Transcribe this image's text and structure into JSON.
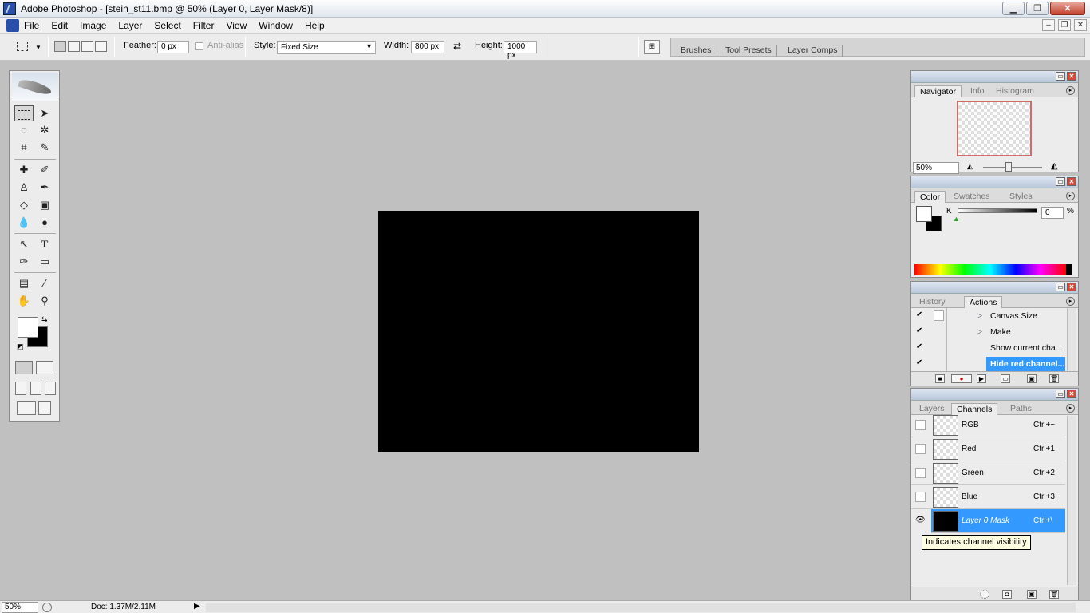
{
  "window": {
    "title": "Adobe Photoshop - [stein_st11.bmp @ 50% (Layer 0, Layer Mask/8)]",
    "min_glyph": "▁",
    "max_glyph": "❐",
    "close_glyph": "✕"
  },
  "menu": {
    "items": [
      "File",
      "Edit",
      "Image",
      "Layer",
      "Select",
      "Filter",
      "View",
      "Window",
      "Help"
    ],
    "doc_min": "–",
    "doc_restore": "❐",
    "doc_close": "✕"
  },
  "options": {
    "feather_label": "Feather:",
    "feather_value": "0 px",
    "antialias_label": "Anti-alias",
    "style_label": "Style:",
    "style_value": "Fixed Size",
    "width_label": "Width:",
    "width_value": "800 px",
    "height_label": "Height:",
    "height_value": "1000 px",
    "swap_glyph": "⇄",
    "well_tabs": [
      "Brushes",
      "Tool Presets",
      "Layer Comps"
    ]
  },
  "toolbox": {
    "colors": {
      "foreground": "#ffffff",
      "background": "#000000"
    }
  },
  "navigator": {
    "tabs": [
      "Navigator",
      "Info",
      "Histogram"
    ],
    "zoom": "50%"
  },
  "color_panel": {
    "tabs": [
      "Color",
      "Swatches",
      "Styles"
    ],
    "channel_label": "K",
    "value": "0",
    "unit": "%"
  },
  "actions": {
    "tabs": [
      "History",
      "Actions"
    ],
    "rows": [
      {
        "check": "✔",
        "label": "Canvas Size",
        "expandable": true
      },
      {
        "check": "✔",
        "label": "Make",
        "expandable": true
      },
      {
        "check": "✔",
        "label": "Show current cha...",
        "expandable": false
      },
      {
        "check": "✔",
        "label": "Hide red channel...",
        "expandable": false,
        "selected": true
      }
    ]
  },
  "channels": {
    "tabs": [
      "Layers",
      "Channels",
      "Paths"
    ],
    "rows": [
      {
        "name": "RGB",
        "shortcut": "Ctrl+~"
      },
      {
        "name": "Red",
        "shortcut": "Ctrl+1"
      },
      {
        "name": "Green",
        "shortcut": "Ctrl+2"
      },
      {
        "name": "Blue",
        "shortcut": "Ctrl+3"
      },
      {
        "name": "Layer 0 Mask",
        "shortcut": "Ctrl+\\",
        "selected": true
      }
    ],
    "tooltip": "Indicates channel visibility"
  },
  "status": {
    "zoom": "50%",
    "doc": "Doc: 1.37M/2.11M"
  }
}
